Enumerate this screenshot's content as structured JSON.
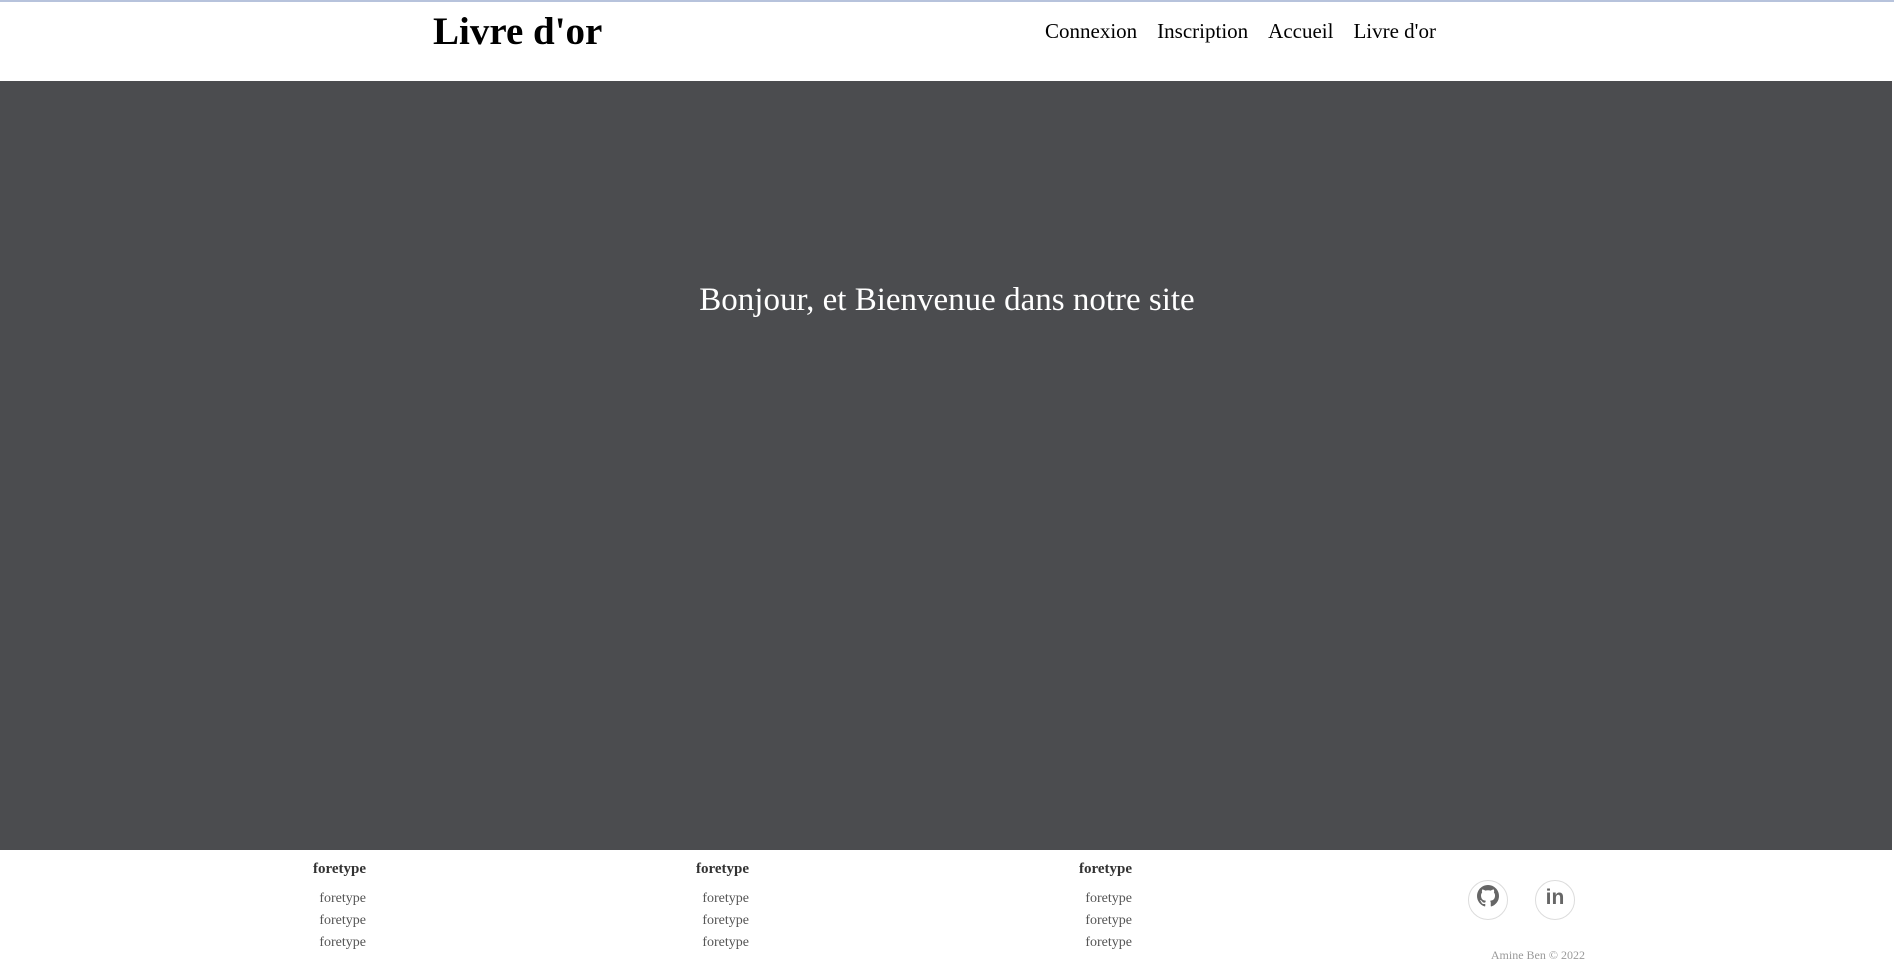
{
  "header": {
    "title": "Livre d'or",
    "nav": [
      "Connexion",
      "Inscription",
      "Accueil",
      "Livre d'or"
    ]
  },
  "hero": {
    "message": "Bonjour, et Bienvenue dans notre site"
  },
  "footer": {
    "columns": [
      {
        "heading": "foretype",
        "links": [
          "foretype",
          "foretype",
          "foretype"
        ]
      },
      {
        "heading": "foretype",
        "links": [
          "foretype",
          "foretype",
          "foretype"
        ]
      },
      {
        "heading": "foretype",
        "links": [
          "foretype",
          "foretype",
          "foretype"
        ]
      }
    ],
    "social": {
      "github_icon": "github-icon",
      "linkedin_icon": "linkedin-icon"
    },
    "copyright": "Amine Ben © 2022"
  },
  "colors": {
    "hero_background": "#4b4c4f",
    "header_background": "#ffffff",
    "text_primary": "#000000",
    "hero_text": "#ffffff"
  }
}
